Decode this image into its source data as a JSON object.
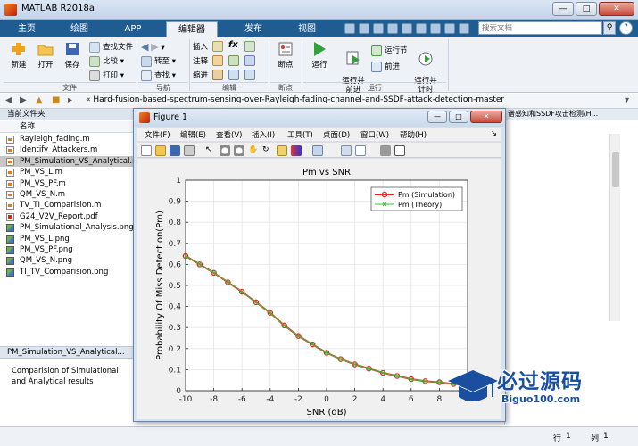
{
  "window": {
    "title": "MATLAB R2018a"
  },
  "tabs": [
    {
      "label": "主页",
      "active": false
    },
    {
      "label": "绘图",
      "active": false
    },
    {
      "label": "APP",
      "active": false
    },
    {
      "label": "编辑器",
      "active": true
    },
    {
      "label": "发布",
      "active": false
    },
    {
      "label": "视图",
      "active": false
    }
  ],
  "search": {
    "placeholder": "搜索文档"
  },
  "ribbon": {
    "file": {
      "new": "新建",
      "open": "打开",
      "save": "保存",
      "find_files": "查找文件",
      "compare": "比较",
      "print": "打印",
      "group": "文件"
    },
    "navigate": {
      "goto": "转至",
      "find": "查找",
      "group": "导航"
    },
    "edit": {
      "insert": "插入",
      "comment": "注释",
      "indent": "缩进",
      "group": "编辑",
      "fx": "fx"
    },
    "breakpoints": {
      "label": "断点",
      "group": "断点"
    },
    "run": {
      "run": "运行",
      "run_advance": "运行并\n前进",
      "run_section": "运行节",
      "advance": "前进",
      "run_time": "运行并\n计时",
      "group": "运行"
    }
  },
  "pathbar": {
    "path": "« Hard-fusion-based-spectrum-sensing-over-Rayleigh-fading-channel-and-SSDF-attack-detection-master"
  },
  "current_folder": {
    "title": "当前文件夹",
    "column": "名称",
    "files": [
      {
        "name": "Rayleigh_fading.m",
        "type": "m"
      },
      {
        "name": "Identify_Attackers.m",
        "type": "m"
      },
      {
        "name": "PM_Simulation_VS_Analytical.m",
        "type": "m",
        "selected": true
      },
      {
        "name": "PM_VS_L.m",
        "type": "m"
      },
      {
        "name": "PM_VS_PF.m",
        "type": "m"
      },
      {
        "name": "QM_VS_N.m",
        "type": "m"
      },
      {
        "name": "TV_TI_Comparision.m",
        "type": "m"
      },
      {
        "name": "G24_V2V_Report.pdf",
        "type": "pdf"
      },
      {
        "name": "PM_Simulational_Analysis.png",
        "type": "png"
      },
      {
        "name": "PM_VS_L.png",
        "type": "png"
      },
      {
        "name": "PM_VS_PF.png",
        "type": "png"
      },
      {
        "name": "QM_VS_N.png",
        "type": "png"
      },
      {
        "name": "TI_TV_Comparision.png",
        "type": "png"
      }
    ]
  },
  "details": {
    "title": "PM_Simulation_VS_Analytical...",
    "text": "Comparision of Simulational and Analytical results"
  },
  "editor_tab": "谱感知和SSDF攻击检测\\H...",
  "status": {
    "row_label": "行",
    "row": "1",
    "col_label": "列",
    "col": "1"
  },
  "figure": {
    "title": "Figure 1",
    "menu": [
      "文件(F)",
      "编辑(E)",
      "查看(V)",
      "插入(I)",
      "工具(T)",
      "桌面(D)",
      "窗口(W)",
      "帮助(H)"
    ]
  },
  "chart_data": {
    "type": "line",
    "title": "Pm vs SNR",
    "xlabel": "SNR (dB)",
    "ylabel": "Probability Of Miss Detection(Pm)",
    "xlim": [
      -10,
      10
    ],
    "ylim": [
      0,
      1
    ],
    "xticks": [
      -10,
      -8,
      -6,
      -4,
      -2,
      0,
      2,
      4,
      6,
      8,
      10
    ],
    "yticks": [
      0,
      0.1,
      0.2,
      0.3,
      0.4,
      0.5,
      0.6,
      0.7,
      0.8,
      0.9,
      1
    ],
    "x": [
      -10,
      -9,
      -8,
      -7,
      -6,
      -5,
      -4,
      -3,
      -2,
      -1,
      0,
      1,
      2,
      3,
      4,
      5,
      6,
      7,
      8,
      9,
      10
    ],
    "series": [
      {
        "name": "Pm (Simulation)",
        "color": "#e8251f",
        "marker": "o",
        "values": [
          0.64,
          0.6,
          0.56,
          0.515,
          0.47,
          0.42,
          0.37,
          0.31,
          0.26,
          0.22,
          0.18,
          0.15,
          0.125,
          0.105,
          0.085,
          0.07,
          0.055,
          0.045,
          0.04,
          0.032,
          0.028
        ]
      },
      {
        "name": "Pm (Theory)",
        "color": "#3cbf3c",
        "marker": "x",
        "values": [
          0.64,
          0.6,
          0.56,
          0.515,
          0.47,
          0.42,
          0.37,
          0.31,
          0.26,
          0.22,
          0.18,
          0.15,
          0.125,
          0.105,
          0.085,
          0.07,
          0.055,
          0.045,
          0.04,
          0.032,
          0.028
        ]
      }
    ],
    "legend": "top-right",
    "grid": true
  },
  "watermark": {
    "cn": "必过源码",
    "en": "Biguo100.com"
  }
}
